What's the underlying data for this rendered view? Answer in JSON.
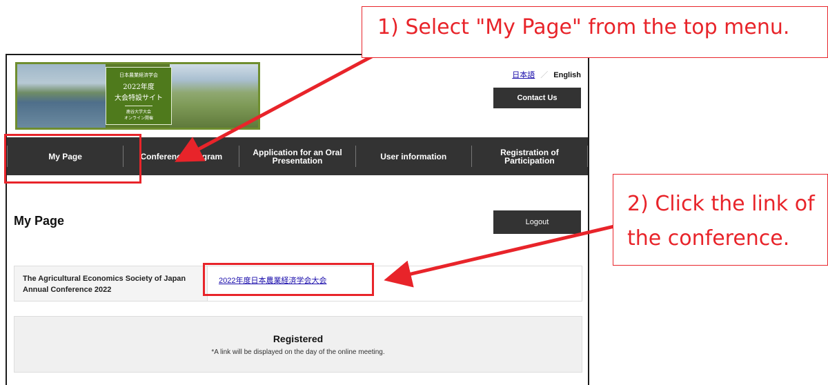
{
  "banner": {
    "line1": "日本農業経済学会",
    "line2": "2022年度",
    "line3": "大会特設サイト",
    "line4": "鹿谷大学大会",
    "line5": "オンライン開催"
  },
  "header": {
    "lang_japanese": "日本語",
    "lang_separator": "／",
    "lang_english": "English",
    "contact_label": "Contact Us"
  },
  "nav": {
    "items": [
      {
        "label": "My Page"
      },
      {
        "label": "Conference Program"
      },
      {
        "label": "Application for an Oral Presentation"
      },
      {
        "label": "User information"
      },
      {
        "label": "Registration of Participation"
      }
    ]
  },
  "main": {
    "heading": "My Page",
    "logout_label": "Logout",
    "conference_name": "The Agricultural Economics Society of Japan Annual Conference 2022",
    "conference_link": "2022年度日本農業経済学会大会",
    "status_title": "Registered",
    "status_note": "*A link will be displayed on the day of the online meeting."
  },
  "annotations": {
    "step1": "1) Select \"My Page\" from the top menu.",
    "step2_line1": "2) Click the link of",
    "step2_line2": "the conference.",
    "color": "#e8242a"
  }
}
